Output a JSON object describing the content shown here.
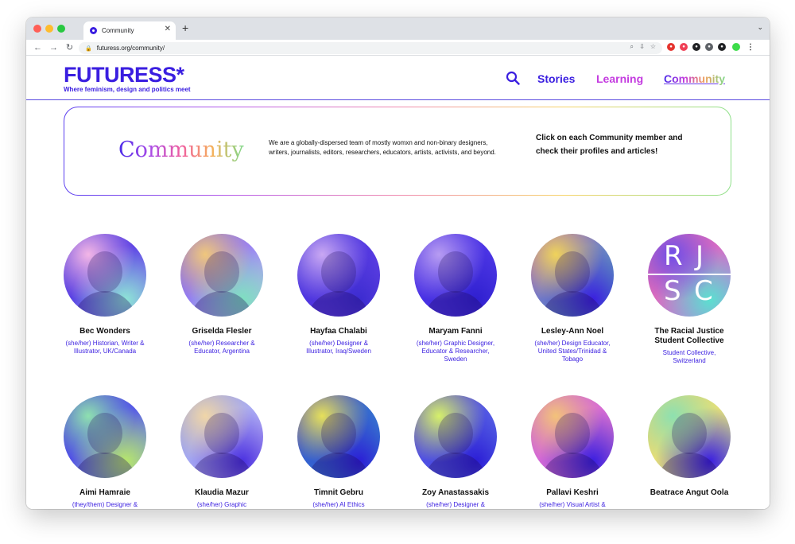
{
  "browser": {
    "tab_title": "Community",
    "new_tab": "+",
    "close": "✕",
    "url": "futuress.org/community/",
    "controls": [
      "←",
      "→",
      "↻"
    ]
  },
  "site": {
    "logo": "FUTURESS*",
    "tagline": "Where feminism, design and politics meet",
    "nav": [
      {
        "label": "Stories",
        "color": "#3a1ee0"
      },
      {
        "label": "Learning",
        "color": "#c43ce0"
      },
      {
        "label": "Community",
        "color": "#6b3ee8"
      }
    ]
  },
  "intro": {
    "title": "Community",
    "text": "We are a globally-dispersed team of mostly womxn and non-binary designers, writers, journalists, editors, researchers, educators, artists, activists, and beyond.",
    "cta": "Click on each Community member and check their profiles and articles!"
  },
  "members": [
    {
      "name": "Bec Wonders",
      "role": "(she/her) Historian, Writer & Illustrator, UK/Canada",
      "colors": [
        "#3e2ad8",
        "#7c5cf2",
        "#f3b6e6",
        "#8ee6d6"
      ]
    },
    {
      "name": "Griselda Flesler",
      "role": "(she/her) Researcher & Educator, Argentina",
      "colors": [
        "#6a4cf0",
        "#c9b7f6",
        "#f0c77c",
        "#7ee0c0"
      ]
    },
    {
      "name": "Hayfaa Chalabi",
      "role": "(she/her) Designer & Illustrator, Iraq/Sweden",
      "colors": [
        "#2b1dd6",
        "#7a52ec",
        "#c9a8f3",
        "#3b2bd0"
      ]
    },
    {
      "name": "Maryam Fanni",
      "role": "(she/her) Graphic Designer, Educator & Researcher, Sweden",
      "colors": [
        "#3a1ee0",
        "#5b48ea",
        "#b79cf2",
        "#2f1fd0"
      ]
    },
    {
      "name": "Lesley-Ann Noel",
      "role": "(she/her) Design Educator, United States/Trinidad & Tobago",
      "colors": [
        "#8f3ee0",
        "#4fc7a8",
        "#f0d35a",
        "#3a1ee0"
      ]
    },
    {
      "name": "The Racial Justice Student Collective",
      "role": "Student Collective, Switzerland",
      "colors": [
        "#f06aa0",
        "#c06ee8",
        "#6f4ee8",
        "#5be0d0"
      ]
    },
    {
      "name": "Aimi Hamraie",
      "role": "(they/them) Designer &",
      "colors": [
        "#3a1ee0",
        "#6d8ef0",
        "#8ee0b0",
        "#b8e86a"
      ]
    },
    {
      "name": "Klaudia Mazur",
      "role": "(she/her) Graphic",
      "colors": [
        "#7a8ef0",
        "#d8c8f6",
        "#f0d6a8",
        "#4a30e0"
      ]
    },
    {
      "name": "Timnit Gebru",
      "role": "(she/her) AI Ethics",
      "colors": [
        "#2b1dd6",
        "#3fb8c8",
        "#e6e05a",
        "#2b1dd6"
      ]
    },
    {
      "name": "Zoy Anastassakis",
      "role": "(she/her) Designer &",
      "colors": [
        "#3a1ee0",
        "#6a8ee8",
        "#d6f06a",
        "#2b1dd6"
      ]
    },
    {
      "name": "Pallavi Keshri",
      "role": "(she/her) Visual Artist &",
      "colors": [
        "#c04ee8",
        "#f08ac0",
        "#f3c27a",
        "#3a1ee0"
      ]
    },
    {
      "name": "Beatrace Angut Oola",
      "role": "",
      "colors": [
        "#f0d06a",
        "#d6f08a",
        "#8ee0b0",
        "#3a1ee0"
      ]
    }
  ]
}
